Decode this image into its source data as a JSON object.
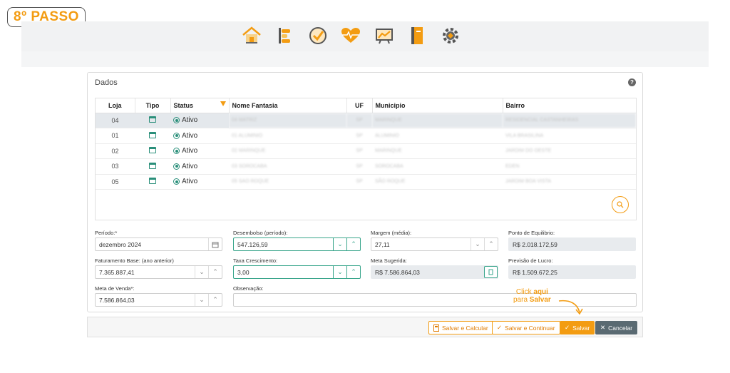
{
  "badge": "8º PASSO",
  "nav_icons": [
    "home-icon",
    "settings-list-icon",
    "check-circle-icon",
    "heart-pulse-icon",
    "chart-icon",
    "notebook-icon",
    "gear-icon"
  ],
  "panel": {
    "title": "Dados",
    "help": "?"
  },
  "table": {
    "headers": [
      "Loja",
      "Tipo",
      "Status",
      "Nome Fantasia",
      "UF",
      "Municipio",
      "Bairro"
    ],
    "rows": [
      {
        "loja": "04",
        "status": "Ativo",
        "nome": "04 MATRIZ",
        "uf": "SP",
        "municipio": "MARINQUE",
        "bairro": "RESIDENCIAL CASTANHEIRAS"
      },
      {
        "loja": "01",
        "status": "Ativo",
        "nome": "01 ALUMINIO",
        "uf": "SP",
        "municipio": "ALUMINIO",
        "bairro": "VILA BRASILINA"
      },
      {
        "loja": "02",
        "status": "Ativo",
        "nome": "02 MARINQUE",
        "uf": "SP",
        "municipio": "MARINQUE",
        "bairro": "JARDIM DO OESTE"
      },
      {
        "loja": "03",
        "status": "Ativo",
        "nome": "03 SOROCABA",
        "uf": "SP",
        "municipio": "SOROCABA",
        "bairro": "EDEN"
      },
      {
        "loja": "05",
        "status": "Ativo",
        "nome": "05 SAO ROQUE",
        "uf": "SP",
        "municipio": "SÃO ROQUE",
        "bairro": "JARDIM BOA VISTA"
      }
    ]
  },
  "form": {
    "periodo_label": "Período:*",
    "periodo_value": "dezembro 2024",
    "desembolso_label": "Desembolso (período):",
    "desembolso_value": "547.126,59",
    "margem_label": "Margem (média):",
    "margem_value": "27,11",
    "ponto_label": "Ponto de Equilibrio:",
    "ponto_value": "R$ 2.018.172,59",
    "faturamento_label": "Faturamento Base: (ano anterior)",
    "faturamento_value": "7.365.887,41",
    "taxa_label": "Taxa Crescimento:",
    "taxa_value": "3,00",
    "meta_sugerida_label": "Meta Sugerida:",
    "meta_sugerida_value": "R$ 7.586.864,03",
    "previsao_label": "Previsão de Lucro:",
    "previsao_value": "R$ 1.509.672,25",
    "meta_label": "Meta de Venda*:",
    "meta_value": "7.586.864,03",
    "obs_label": "Observação:",
    "obs_value": ""
  },
  "annotation": {
    "line1_pre": "Click ",
    "line1_bold": "aqui",
    "line2_pre": "para ",
    "line2_bold": "Salvar"
  },
  "buttons": {
    "salvar_calcular": "Salvar e Calcular",
    "salvar_continuar": "Salvar e Continuar",
    "salvar": "Salvar",
    "cancelar": "Cancelar"
  },
  "colors": {
    "accent": "#f39c12",
    "green": "#2a8f7a",
    "cancel": "#5a6a72"
  }
}
